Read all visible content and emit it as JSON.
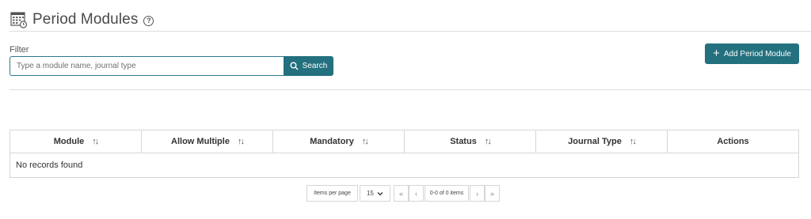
{
  "header": {
    "title": "Period Modules",
    "help_glyph": "?"
  },
  "filter": {
    "label": "Filter",
    "search_placeholder": "Type a module name, journal type",
    "search_value": "",
    "search_button_label": "Search"
  },
  "actions": {
    "add_button_label": "Add Period Module"
  },
  "table": {
    "columns": [
      {
        "label": "Module",
        "sortable": true
      },
      {
        "label": "Allow Multiple",
        "sortable": true
      },
      {
        "label": "Mandatory",
        "sortable": true
      },
      {
        "label": "Status",
        "sortable": true
      },
      {
        "label": "Journal Type",
        "sortable": true
      },
      {
        "label": "Actions",
        "sortable": false
      }
    ],
    "empty_message": "No records found"
  },
  "pager": {
    "items_per_page_label": "Items per page",
    "page_size": "15",
    "range_info": "0-0 of 0 items",
    "first_glyph": "«",
    "prev_glyph": "‹",
    "next_glyph": "›",
    "last_glyph": "»"
  },
  "colors": {
    "accent": "#23707f",
    "border": "#d6d6d6"
  }
}
